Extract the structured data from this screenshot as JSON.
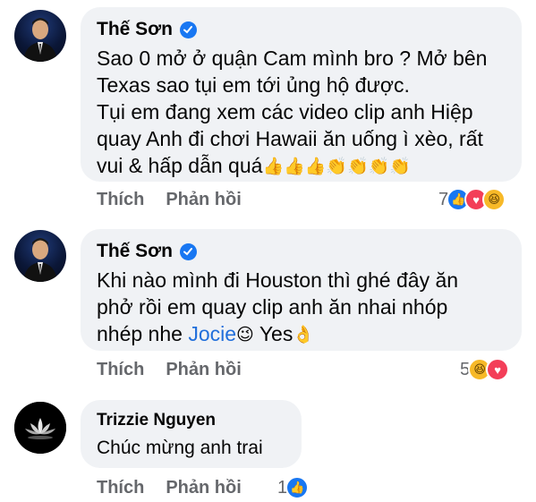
{
  "comments": [
    {
      "author": "Thế Sơn",
      "verified": true,
      "lines": [
        "Sao 0 mở ở quận Cam mình bro ? Mở bên",
        "Texas sao tụi em tới ủng hộ được.",
        "Tụi em đang xem các video clip anh Hiệp",
        "quay Anh đi chơi Hawaii ăn uống ì xèo, rất",
        "vui & hấp dẫn quá"
      ],
      "emoji_tail": "👍👍👍👏👏👏👏",
      "like_label": "Thích",
      "reply_label": "Phản hồi",
      "reaction_count": "7",
      "reaction_icons": [
        "like-icon",
        "love-icon",
        "haha-icon"
      ]
    },
    {
      "author": "Thế Sơn",
      "verified": true,
      "lines": [
        "Khi nào mình đi Houston thì ghé đây ăn",
        "phở rồi em quay clip anh ăn nhai nhóp"
      ],
      "line3_prefix": "nhép nhe ",
      "mention": "Jocie",
      "line3_suffix": " Yes",
      "emoji_wink": "😉",
      "emoji_ok": "👌",
      "like_label": "Thích",
      "reply_label": "Phản hồi",
      "reaction_count": "5",
      "reaction_icons": [
        "haha-icon",
        "love-icon"
      ]
    },
    {
      "author": "Trizzie Nguyen",
      "verified": false,
      "text": "Chúc mừng anh trai",
      "like_label": "Thích",
      "reply_label": "Phản hồi",
      "reaction_count": "1",
      "reaction_icons": [
        "like-icon"
      ]
    }
  ],
  "colors": {
    "bubble": "#f0f2f5",
    "action_text": "#65676b",
    "mention": "#216fdb",
    "verified": "#1877f2"
  }
}
